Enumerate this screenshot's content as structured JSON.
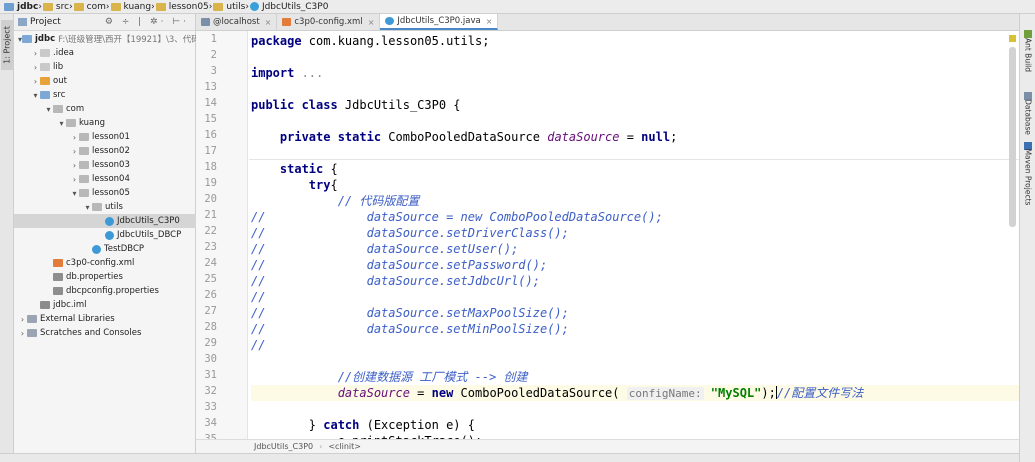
{
  "breadcrumb": [
    "jdbc",
    "src",
    "com",
    "kuang",
    "lesson05",
    "utils",
    "JdbcUtils_C3P0"
  ],
  "left_strip": {
    "project_tab": "1: Project"
  },
  "project": {
    "title": "Project",
    "tools": "⚙ ÷ | ✲· ⊢·",
    "tree": [
      {
        "label": "jdbc",
        "path": "F:\\班级管理\\西开【19921】\\3、代码",
        "indent": 0,
        "arrow": "▾",
        "icon": "folder-b",
        "bold": true
      },
      {
        "label": ".idea",
        "indent": 1,
        "arrow": "›",
        "icon": "folder"
      },
      {
        "label": "lib",
        "indent": 1,
        "arrow": "›",
        "icon": "folder"
      },
      {
        "label": "out",
        "indent": 1,
        "arrow": "›",
        "icon": "folder-y"
      },
      {
        "label": "src",
        "indent": 1,
        "arrow": "▾",
        "icon": "folder-b"
      },
      {
        "label": "com",
        "indent": 2,
        "arrow": "▾",
        "icon": "pkg"
      },
      {
        "label": "kuang",
        "indent": 3,
        "arrow": "▾",
        "icon": "pkg"
      },
      {
        "label": "lesson01",
        "indent": 4,
        "arrow": "›",
        "icon": "pkg"
      },
      {
        "label": "lesson02",
        "indent": 4,
        "arrow": "›",
        "icon": "pkg"
      },
      {
        "label": "lesson03",
        "indent": 4,
        "arrow": "›",
        "icon": "pkg"
      },
      {
        "label": "lesson04",
        "indent": 4,
        "arrow": "›",
        "icon": "pkg"
      },
      {
        "label": "lesson05",
        "indent": 4,
        "arrow": "▾",
        "icon": "pkg"
      },
      {
        "label": "utils",
        "indent": 5,
        "arrow": "▾",
        "icon": "pkg"
      },
      {
        "label": "JdbcUtils_C3P0",
        "indent": 6,
        "arrow": "",
        "icon": "java",
        "selected": true
      },
      {
        "label": "JdbcUtils_DBCP",
        "indent": 6,
        "arrow": "",
        "icon": "java"
      },
      {
        "label": "TestDBCP",
        "indent": 5,
        "arrow": "",
        "icon": "java"
      },
      {
        "label": "c3p0-config.xml",
        "indent": 2,
        "arrow": "",
        "icon": "xml"
      },
      {
        "label": "db.properties",
        "indent": 2,
        "arrow": "",
        "icon": "prop"
      },
      {
        "label": "dbcpconfig.properties",
        "indent": 2,
        "arrow": "",
        "icon": "prop"
      },
      {
        "label": "jdbc.iml",
        "indent": 1,
        "arrow": "",
        "icon": "mod"
      },
      {
        "label": "External Libraries",
        "indent": 0,
        "arrow": "›",
        "icon": "lib"
      },
      {
        "label": "Scratches and Consoles",
        "indent": 0,
        "arrow": "›",
        "icon": "lib"
      }
    ]
  },
  "tabs": [
    {
      "label": "@localhost",
      "icon": "db",
      "active": false
    },
    {
      "label": "c3p0-config.xml",
      "icon": "xml",
      "active": false
    },
    {
      "label": "JdbcUtils_C3P0.java",
      "icon": "java",
      "active": true
    }
  ],
  "editor": {
    "lines": [
      {
        "n": "1",
        "tokens": [
          [
            "kw",
            "package "
          ],
          [
            "",
            "com.kuang.lesson05.utils;"
          ]
        ]
      },
      {
        "n": "2",
        "tokens": []
      },
      {
        "n": "3",
        "tokens": [
          [
            "kw",
            "import "
          ],
          [
            "dim",
            "..."
          ]
        ]
      },
      {
        "n": "13",
        "tokens": []
      },
      {
        "n": "14",
        "tokens": [
          [
            "kw",
            "public class "
          ],
          [
            "",
            "JdbcUtils_C3P0 {"
          ]
        ]
      },
      {
        "n": "15",
        "tokens": []
      },
      {
        "n": "16",
        "tokens": [
          [
            "",
            "    "
          ],
          [
            "kw",
            "private static "
          ],
          [
            "",
            "ComboPooledDataSource "
          ],
          [
            "fld",
            "dataSource"
          ],
          [
            "",
            " = "
          ],
          [
            "kw",
            "null"
          ],
          [
            "",
            ";"
          ]
        ]
      },
      {
        "n": "17",
        "tokens": []
      },
      {
        "n": "18",
        "tokens": [
          [
            "",
            "    "
          ],
          [
            "kw",
            "static "
          ],
          [
            "",
            "{"
          ]
        ]
      },
      {
        "n": "19",
        "tokens": [
          [
            "",
            "        "
          ],
          [
            "kw",
            "try"
          ],
          [
            "",
            "{"
          ]
        ]
      },
      {
        "n": "20",
        "tokens": [
          [
            "",
            "            "
          ],
          [
            "cmt2",
            "// 代码版配置"
          ]
        ]
      },
      {
        "n": "21",
        "tokens": [
          [
            "cmt2",
            "//              dataSource = new ComboPooledDataSource();"
          ]
        ]
      },
      {
        "n": "22",
        "tokens": [
          [
            "cmt2",
            "//              dataSource.setDriverClass();"
          ]
        ]
      },
      {
        "n": "23",
        "tokens": [
          [
            "cmt2",
            "//              dataSource.setUser();"
          ]
        ]
      },
      {
        "n": "24",
        "tokens": [
          [
            "cmt2",
            "//              dataSource.setPassword();"
          ]
        ]
      },
      {
        "n": "25",
        "tokens": [
          [
            "cmt2",
            "//              dataSource.setJdbcUrl();"
          ]
        ]
      },
      {
        "n": "26",
        "tokens": [
          [
            "cmt2",
            "//"
          ]
        ]
      },
      {
        "n": "27",
        "tokens": [
          [
            "cmt2",
            "//              dataSource.setMaxPoolSize();"
          ]
        ]
      },
      {
        "n": "28",
        "tokens": [
          [
            "cmt2",
            "//              dataSource.setMinPoolSize();"
          ]
        ]
      },
      {
        "n": "29",
        "tokens": [
          [
            "cmt2",
            "//"
          ]
        ]
      },
      {
        "n": "30",
        "tokens": []
      },
      {
        "n": "31",
        "tokens": [
          [
            "",
            "            "
          ],
          [
            "cmt2",
            "//创建数据源 工厂模式 --> 创建"
          ]
        ]
      },
      {
        "n": "32",
        "tokens": [
          [
            "",
            "            "
          ],
          [
            "fld",
            "dataSource"
          ],
          [
            "",
            " = "
          ],
          [
            "kw",
            "new "
          ],
          [
            "",
            "ComboPooledDataSource( "
          ],
          [
            "hint",
            "configName:"
          ],
          [
            "",
            ""
          ],
          [
            "str",
            " \"MySQL\""
          ],
          [
            "",
            ");"
          ],
          [
            "caret",
            ""
          ],
          [
            "cmt2",
            "//配置文件写法"
          ]
        ],
        "current": true
      },
      {
        "n": "33",
        "tokens": []
      },
      {
        "n": "34",
        "tokens": [
          [
            "",
            "        } "
          ],
          [
            "kw",
            "catch "
          ],
          [
            "",
            "(Exception e) {"
          ]
        ]
      },
      {
        "n": "35",
        "tokens": [
          [
            "",
            "            e.printStackTrace();"
          ]
        ]
      }
    ]
  },
  "editor_footer": [
    "JdbcUtils_C3P0",
    "<clinit>"
  ],
  "right_strip": [
    "Ant Build",
    "Database",
    "Maven Projects"
  ]
}
